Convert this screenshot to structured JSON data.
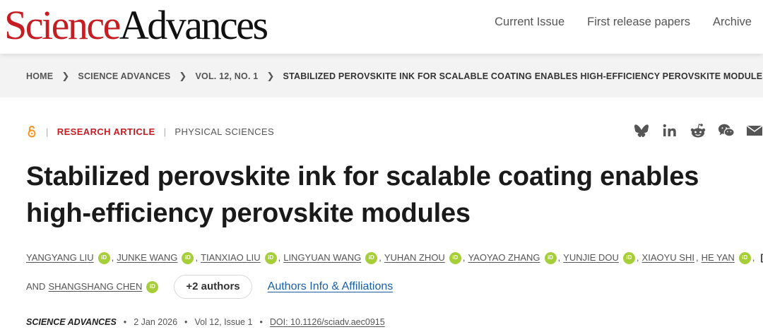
{
  "header": {
    "logo_part1": "Science",
    "logo_part2": "Advances",
    "nav": [
      "Current Issue",
      "First release papers",
      "Archive"
    ]
  },
  "breadcrumb": [
    "HOME",
    "SCIENCE ADVANCES",
    "VOL. 12, NO. 1",
    "STABILIZED PEROVSKITE INK FOR SCALABLE COATING ENABLES HIGH-EFFICIENCY PEROVSKITE MODULES"
  ],
  "article": {
    "type": "RESEARCH ARTICLE",
    "subject": "PHYSICAL SCIENCES",
    "title": "Stabilized perovskite ink for scalable coating enables high-efficiency perovskite modules",
    "authors_row1": [
      "YANGYANG LIU",
      "JUNKE WANG",
      "TIANXIAO LIU",
      "LINGYUAN WANG",
      "YUHAN ZHOU",
      "YAOYAO ZHANG",
      "YUNJIE DOU",
      "XIAOYU SHI",
      "HE YAN"
    ],
    "ellipsis": "[...]",
    "and_label": "AND",
    "last_author": "SHANGSHANG CHEN",
    "more_authors": "+2 authors",
    "affiliations_link": "Authors Info & Affiliations",
    "orcid_label": "iD",
    "journal": "SCIENCE ADVANCES",
    "date": "2 Jan 2026",
    "volume": "Vol 12, Issue 1",
    "doi": "DOI: 10.1126/sciadv.aec0915"
  },
  "share_icons": [
    "bluesky-icon",
    "linkedin-icon",
    "reddit-icon",
    "wechat-icon",
    "email-icon"
  ],
  "colors": {
    "brand_red": "#c41e24",
    "link_blue": "#1a5fa8",
    "orcid_green": "#a6ce39"
  }
}
